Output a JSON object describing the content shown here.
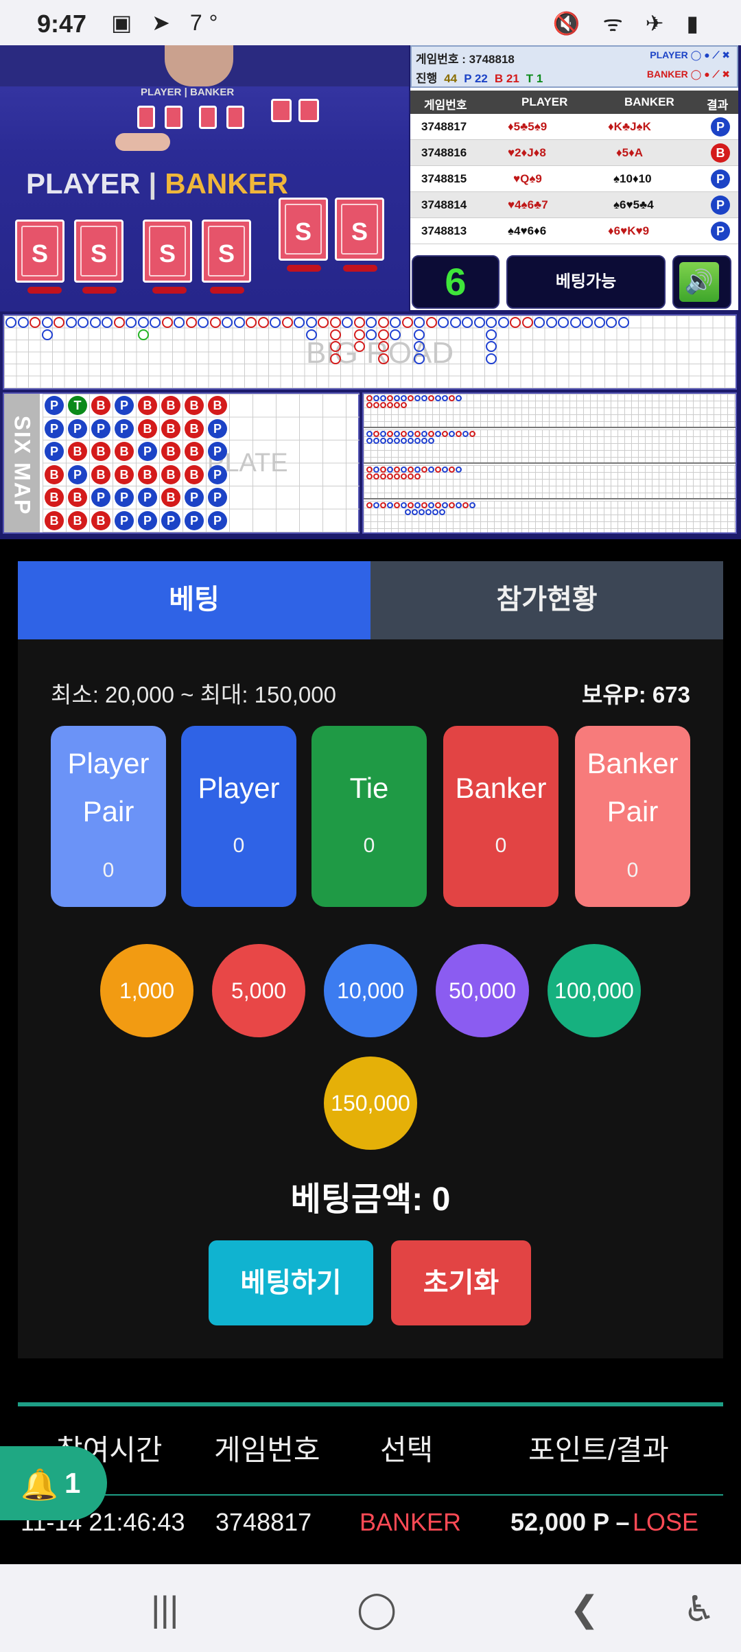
{
  "status_bar": {
    "time": "9:47",
    "left_icons": "▣ ➤ 7°",
    "right_icons": "🔇 ᯤ ✈ ▮"
  },
  "game": {
    "video_label_small": "PLAYER | BANKER",
    "video_player": "PLAYER",
    "video_banker": "BANKER",
    "card_brand": "SKY",
    "game_number_label": "게임번호 : 3748818",
    "progress_label": "진행",
    "progress_total": "44",
    "progress_p": "P 22",
    "progress_b": "B 21",
    "progress_t": "T 1",
    "legend_player": "PLAYER",
    "legend_banker": "BANKER",
    "table_headers": [
      "게임번호",
      "PLAYER",
      "BANKER",
      "결과"
    ],
    "rows": [
      {
        "id": "3748817",
        "player": "♦5♣5♠9",
        "banker": "♦K♣J♠K",
        "result": "P"
      },
      {
        "id": "3748816",
        "player": "♥2♦J♦8",
        "banker": "♦5♦A",
        "result": "B"
      },
      {
        "id": "3748815",
        "player": "♥Q♠9",
        "banker": "♠10♦10",
        "result": "P"
      },
      {
        "id": "3748814",
        "player": "♥4♠6♣7",
        "banker": "♠6♥5♣4",
        "result": "P"
      },
      {
        "id": "3748813",
        "player": "♠4♥6♦6",
        "banker": "♦6♥K♥9",
        "result": "P"
      }
    ],
    "countdown": "6",
    "bet_status": "베팅가능",
    "bigroad_label": "BIG ROAD",
    "sixmap_label": "SIX MAP",
    "sixmap_watermark": "PLATE"
  },
  "panel": {
    "tabs": [
      "베팅",
      "참가현황"
    ],
    "limits": "최소: 20,000 ~ 최대: 150,000",
    "points": "보유P: 673",
    "bets": [
      {
        "label1": "Player",
        "label2": "Pair",
        "value": "0",
        "color": "#6b93f7"
      },
      {
        "label1": "Player",
        "label2": "",
        "value": "0",
        "color": "#2f63e6"
      },
      {
        "label1": "Tie",
        "label2": "",
        "value": "0",
        "color": "#1f9a45"
      },
      {
        "label1": "Banker",
        "label2": "",
        "value": "0",
        "color": "#e24444"
      },
      {
        "label1": "Banker",
        "label2": "Pair",
        "value": "0",
        "color": "#f77b7b"
      }
    ],
    "chips": [
      {
        "label": "1,000",
        "color": "#f29b12"
      },
      {
        "label": "5,000",
        "color": "#e84747"
      },
      {
        "label": "10,000",
        "color": "#3c7cf0"
      },
      {
        "label": "50,000",
        "color": "#8b5cf1"
      },
      {
        "label": "100,000",
        "color": "#16b17f"
      },
      {
        "label": "150,000",
        "color": "#e5b008"
      }
    ],
    "amount": "베팅금액: 0",
    "submit": "베팅하기",
    "reset": "초기화"
  },
  "history": {
    "headers": [
      "참여시간",
      "게임번호",
      "선택",
      "포인트/결과"
    ],
    "row": {
      "time": "11-14 21:46:43",
      "game": "3748817",
      "choice": "BANKER",
      "points": "52,000 P –",
      "result": "LOSE"
    }
  },
  "notification": {
    "count": "1"
  },
  "nav": {
    "recents": "|||",
    "home": "◯",
    "back": "❮",
    "access": "♿"
  }
}
